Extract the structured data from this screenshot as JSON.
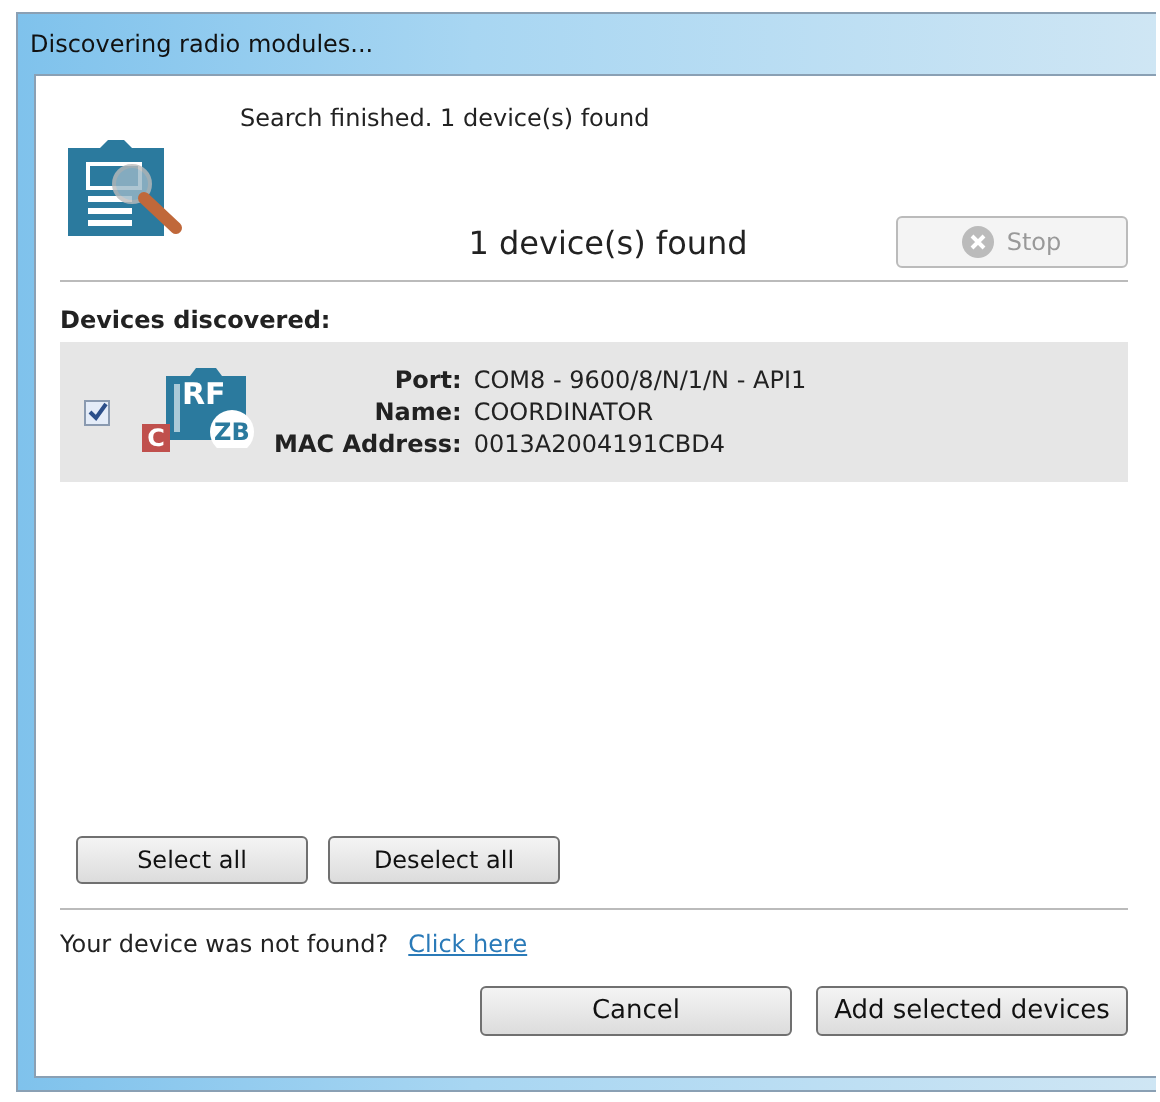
{
  "window": {
    "title": "Discovering radio modules..."
  },
  "status": "Search finished. 1 device(s) found",
  "found_count": "1 device(s) found",
  "stop_button": {
    "label": "Stop",
    "disabled": true
  },
  "devices_heading": "Devices discovered:",
  "devices": [
    {
      "checked": true,
      "module_label": "RF",
      "badge": "C",
      "protocol": "ZB",
      "fields": [
        {
          "label": "Port:",
          "value": "COM8 - 9600/8/N/1/N - API1"
        },
        {
          "label": "Name:",
          "value": "COORDINATOR"
        },
        {
          "label": "MAC Address:",
          "value": "0013A2004191CBD4"
        }
      ]
    }
  ],
  "select_all": "Select all",
  "deselect_all": "Deselect all",
  "not_found": {
    "text": "Your device was not found?",
    "link": "Click here"
  },
  "buttons": [
    "Cancel",
    "Add selected devices"
  ]
}
